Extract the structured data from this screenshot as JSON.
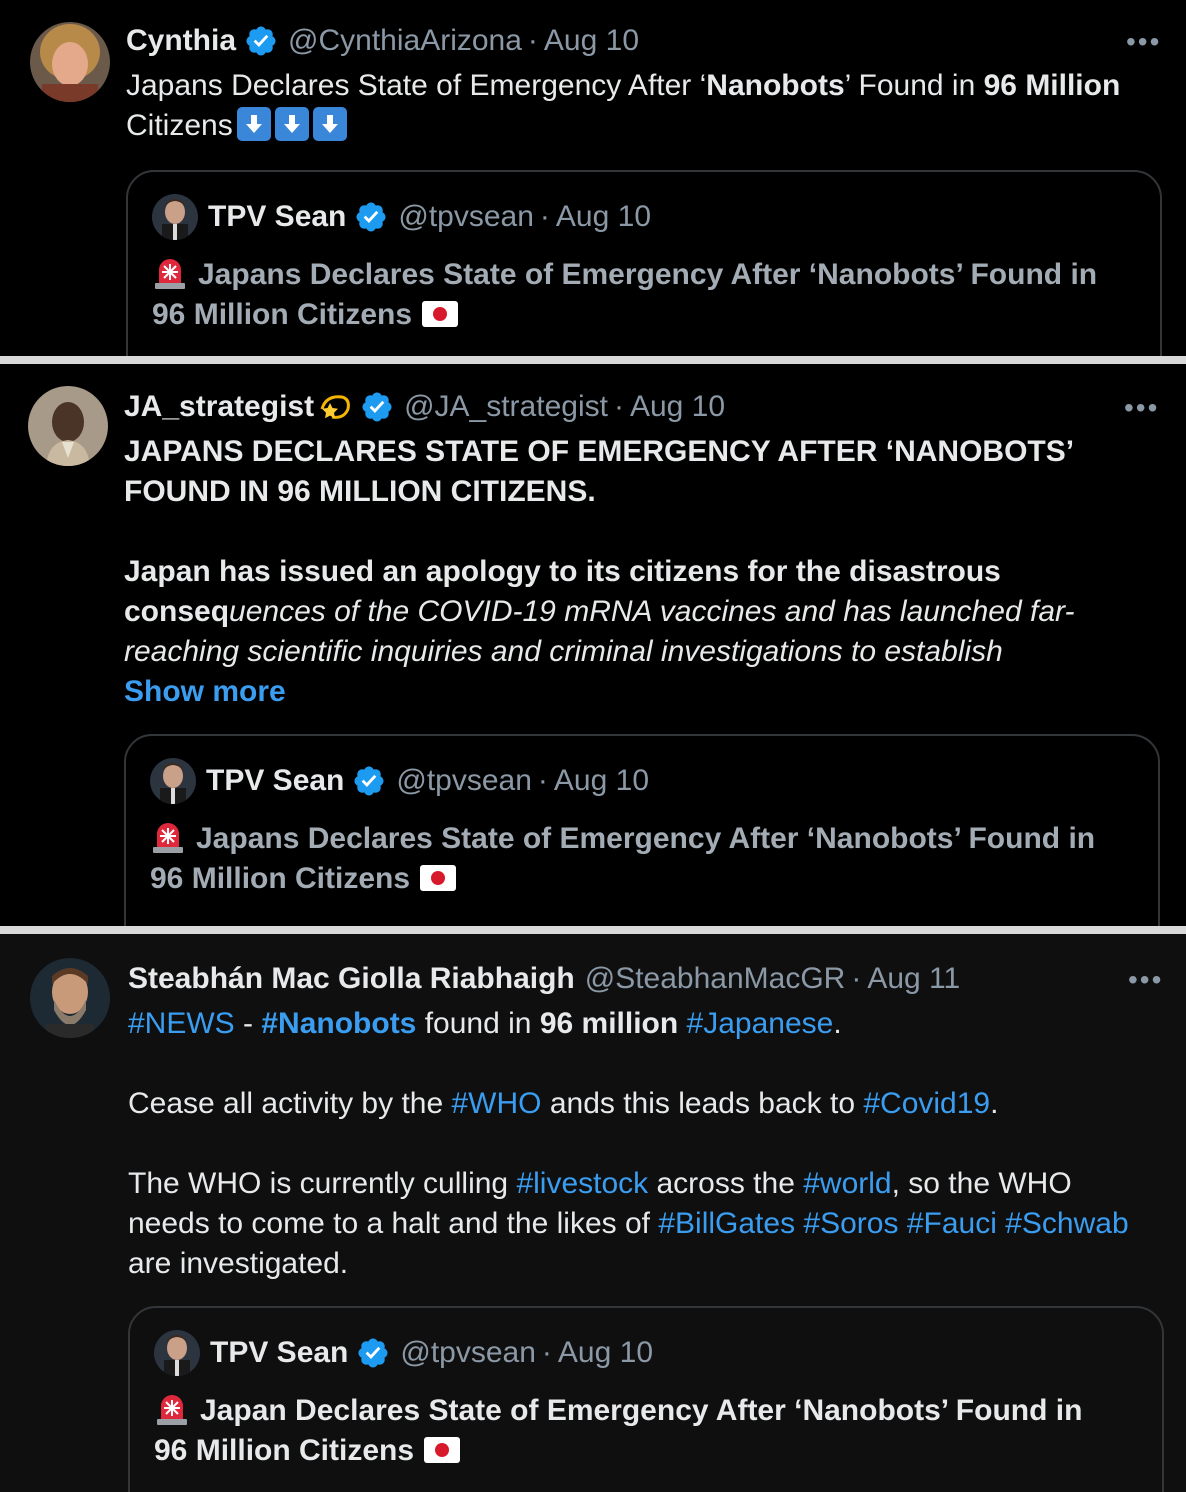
{
  "tweets": [
    {
      "name": "Cynthia",
      "handle": "@CynthiaArizona",
      "separator": "·",
      "date": "Aug 10",
      "more": "•••",
      "text": {
        "line1_a": "Japans Declares State of Emergency After ‘",
        "line1_b": "Nanobots",
        "line1_c": "’ Found in ",
        "line1_d": "96 Million",
        "line2": "Citizens",
        "emoji": "down-arrow-emoji"
      },
      "quote": {
        "name": "TPV Sean",
        "handle": "@tpvsean",
        "separator": "·",
        "date": "Aug 10",
        "line1": "Japans Declares State of Emergency After ‘Nanobots’ Found in",
        "line2": "96 Million Citizens"
      }
    },
    {
      "name": "JA_strategist",
      "handle": "@JA_strategist",
      "separator": "·",
      "date": "Aug 10",
      "more": "•••",
      "text": {
        "line1": "JAPANS DECLARES STATE OF EMERGENCY AFTER ‘NANOBOTS’",
        "line2": "FOUND IN 96 MILLION CITIZENS.",
        "line3": "Japan has issued an apology to its citizens for the disastrous",
        "line4_a": "conseq",
        "line4_b": "uences of the COVID-19 mRNA vaccines and has launched far-",
        "line5": "reaching scientific inquiries and criminal investigations to establish",
        "show_more": "Show more"
      },
      "quote": {
        "name": "TPV Sean",
        "handle": "@tpvsean",
        "separator": "·",
        "date": "Aug 10",
        "line1": "Japans Declares State of Emergency After ‘Nanobots’ Found in",
        "line2": "96 Million Citizens"
      }
    },
    {
      "name": "Steabhán Mac Giolla Riabhaigh",
      "handle": "@SteabhanMacGR",
      "separator": "·",
      "date": "Aug 11",
      "more": "•••",
      "text": {
        "p1": [
          "#NEWS",
          " - ",
          "#Nanobots",
          " found in ",
          "96 million",
          " ",
          "#Japanese",
          "."
        ],
        "p2": [
          "Cease all activity by the ",
          "#WHO",
          " ands this leads back to ",
          "#Covid19",
          "."
        ],
        "p3a": [
          "The WHO is currently culling ",
          "#livestock",
          " across the ",
          "#world",
          ", so the WHO"
        ],
        "p3b": [
          "needs to come to a halt and the likes of ",
          "#BillGates",
          " ",
          "#Soros",
          " ",
          "#Fauci",
          " ",
          "#Schwab"
        ],
        "p3c": "are investigated."
      },
      "quote": {
        "name": "TPV Sean",
        "handle": "@tpvsean",
        "separator": "·",
        "date": "Aug 10",
        "line1": "Japan Declares State of Emergency After ‘Nanobots’ Found in",
        "line2": "96 Million Citizens"
      }
    }
  ],
  "colors": {
    "background": "#000000",
    "text": "#e7e9ea",
    "secondary": "#8b98a5",
    "link": "#3b9df0",
    "verified": "#1d9bf0",
    "separator": "#d9d9d9"
  }
}
